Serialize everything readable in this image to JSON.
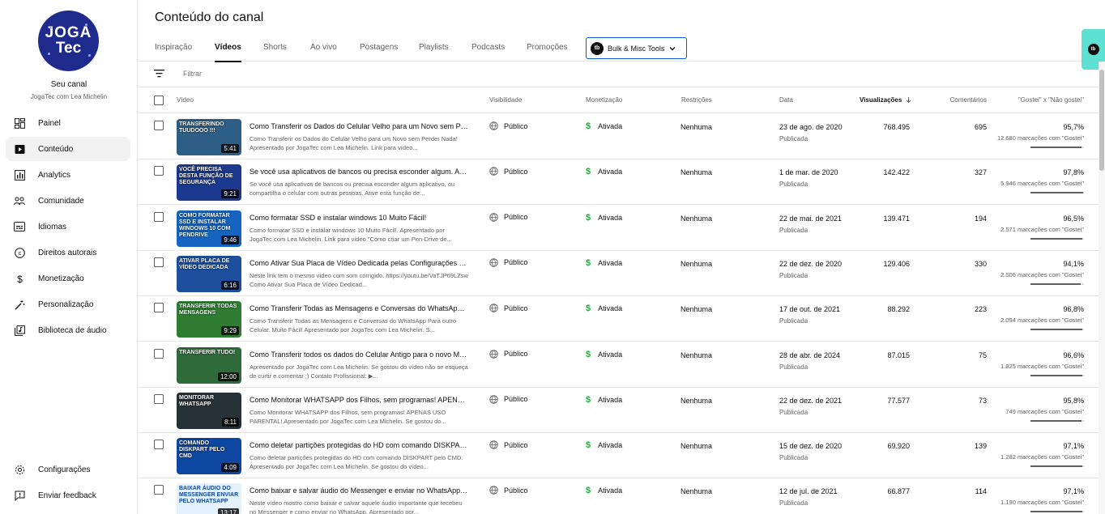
{
  "channel": {
    "avatar_line1": "JOGA",
    "avatar_line2": "Tec",
    "title": "Seu canal",
    "name": "JogaTec com Lea Michelin"
  },
  "nav": [
    {
      "label": "Painel",
      "icon": "dashboard-icon"
    },
    {
      "label": "Conteúdo",
      "icon": "content-icon",
      "active": true
    },
    {
      "label": "Analytics",
      "icon": "analytics-icon"
    },
    {
      "label": "Comunidade",
      "icon": "community-icon"
    },
    {
      "label": "Idiomas",
      "icon": "subtitles-icon"
    },
    {
      "label": "Direitos autorais",
      "icon": "copyright-icon"
    },
    {
      "label": "Monetização",
      "icon": "dollar-icon"
    },
    {
      "label": "Personalização",
      "icon": "magic-wand-icon"
    },
    {
      "label": "Biblioteca de áudio",
      "icon": "audio-library-icon"
    }
  ],
  "footer_nav": [
    {
      "label": "Configurações",
      "icon": "gear-icon"
    },
    {
      "label": "Enviar feedback",
      "icon": "feedback-icon"
    }
  ],
  "page_title": "Conteúdo do canal",
  "tabs": [
    "Inspiração",
    "Vídeos",
    "Shorts",
    "Ao vivo",
    "Postagens",
    "Playlists",
    "Podcasts",
    "Promoções"
  ],
  "active_tab": "Vídeos",
  "bulk_tools": {
    "label": "Bulk & Misc Tools",
    "logo": "tb"
  },
  "filter": {
    "placeholder": "Filtrar"
  },
  "columns": {
    "video": "Vídeo",
    "visibility": "Visibilidade",
    "monetization": "Monetização",
    "restrictions": "Restrições",
    "date": "Data",
    "views": "Visualizações",
    "comments": "Comentários",
    "likes": "\"Gostei\" x \"Não gostei\""
  },
  "colors": {
    "accent": "#0b57d0",
    "monetized": "#2ba640",
    "teal_tool": "#5ee0d3"
  },
  "videos": [
    {
      "thumb_text": "Transferindo TUUDOOO !!!",
      "thumb_color": "#2d5e86",
      "duration": "5:41",
      "title": "Como Transferir os Dados do Celular Velho para um Novo sem Perder Nada!",
      "desc": "Como Transferir os Dados do Celular Velho para um Novo sem Perder Nada! Apresentado por JogaTec com Lea Michelin. Link para vídeo...",
      "visibility": "Público",
      "monetization": "Ativada",
      "restrictions": "Nenhuma",
      "date": "23 de ago. de 2020",
      "status": "Publicada",
      "views": "768.495",
      "comments": "695",
      "like_pct": "95,7%",
      "like_ratio": 0.957,
      "like_count": "12.680 marcações com \"Gostei\""
    },
    {
      "thumb_text": "Você precisa desta função de segurança",
      "thumb_color": "#1b3a8f",
      "duration": "9:21",
      "title": "Se você usa aplicativos de bancos ou precisa esconder algum. Ativa esta função",
      "desc": "Se você usa aplicativos de bancos ou precisa esconder algum aplicativo, ou compartilha o celular com outras pessoas. Ative esta função de...",
      "visibility": "Público",
      "monetization": "Ativada",
      "restrictions": "Nenhuma",
      "date": "1 de mar. de 2020",
      "status": "Publicada",
      "views": "142.422",
      "comments": "327",
      "like_pct": "97,8%",
      "like_ratio": 0.978,
      "like_count": "5.946 marcações com \"Gostei\""
    },
    {
      "thumb_text": "Como formatar SSD e instalar Windows 10 com pendrive",
      "thumb_color": "#1565c0",
      "duration": "9:46",
      "title": "Como formatar SSD e instalar windows 10 Muito Fácil!",
      "desc": "Como formatar SSD e instalar windows 10 Muito Fácil!. Apresentado por JogaTec com Lea Michelin. Link para vídeo \"Como criar um Pen-Drive de...",
      "visibility": "Público",
      "monetization": "Ativada",
      "restrictions": "Nenhuma",
      "date": "22 de mai. de 2021",
      "status": "Publicada",
      "views": "139.471",
      "comments": "194",
      "like_pct": "96,5%",
      "like_ratio": 0.965,
      "like_count": "2.571 marcações com \"Gostei\""
    },
    {
      "thumb_text": "Ativar placa de vídeo dedicada",
      "thumb_color": "#1d4f9e",
      "duration": "6:16",
      "title": "Como Ativar Sua Placa de Vídeo Dedicada pelas Configurações do Windows",
      "desc": "Neste link tem o mesmo vídeo com som corrigido. https://youtu.be/VaTJP69LZsw Como Ativar Sua Placa de Vídeo Dedicad...",
      "visibility": "Público",
      "monetization": "Ativada",
      "restrictions": "Nenhuma",
      "date": "22 de dez. de 2020",
      "status": "Publicada",
      "views": "129.406",
      "comments": "330",
      "like_pct": "94,1%",
      "like_ratio": 0.941,
      "like_count": "2.506 marcações com \"Gostei\""
    },
    {
      "thumb_text": "Transferir todas mensagens",
      "thumb_color": "#2e7d32",
      "duration": "9:29",
      "title": "Como Transferir Todas as Mensagens e Conversas do WhatsApp Para outro Celular",
      "desc": "Como Transferir Todas as Mensagens e Conversas do WhatsApp Para outro Celular. Muito Fácil! Apresentado por JogaTec com Lea Michelin. S...",
      "visibility": "Público",
      "monetization": "Ativada",
      "restrictions": "Nenhuma",
      "date": "17 de out. de 2021",
      "status": "Publicada",
      "views": "88.292",
      "comments": "223",
      "like_pct": "96,8%",
      "like_ratio": 0.968,
      "like_count": "2.094 marcações com \"Gostei\""
    },
    {
      "thumb_text": "Transferir tudo!",
      "thumb_color": "#2f6b3a",
      "duration": "12:00",
      "title": "Como Transferir todos os dados do Celular Antigo para o novo Muito Fácil",
      "desc": "Apresentado por JogaTec com Lea Michelin. Se gostou do vídeo não se esqueça de curtir e comentar ;) Contato Profissional: ▶...",
      "visibility": "Público",
      "monetization": "Ativada",
      "restrictions": "Nenhuma",
      "date": "28 de abr. de 2024",
      "status": "Publicada",
      "views": "87.015",
      "comments": "75",
      "like_pct": "96,6%",
      "like_ratio": 0.966,
      "like_count": "1.825 marcações com \"Gostei\""
    },
    {
      "thumb_text": "Monitorar WhatsApp",
      "thumb_color": "#263238",
      "duration": "8:11",
      "title": "Como Monitorar WHATSAPP dos Filhos, sem programas! APENAS USO PARENTAL",
      "desc": "Como Monitorar WHATSAPP dos Filhos, sem programas! APENAS USO PARENTAL! Apresentado por JogaTec com Lea Michelin. Se gostou do...",
      "visibility": "Público",
      "monetization": "Ativada",
      "restrictions": "Nenhuma",
      "date": "22 de dez. de 2021",
      "status": "Publicada",
      "views": "77.577",
      "comments": "73",
      "like_pct": "95,8%",
      "like_ratio": 0.958,
      "like_count": "749 marcações com \"Gostei\""
    },
    {
      "thumb_text": "Comando DISKPART pelo CMD",
      "thumb_color": "#0d47a1",
      "duration": "4:09",
      "title": "Como deletar partições protegidas do HD com comando DISKPART pelo CMD",
      "desc": "Como deletar partições protegidas do HD com comando DISKPART pelo CMD. Apresentado por JogaTec com Lea Michelin. Se gostou do vídeo...",
      "visibility": "Público",
      "monetization": "Ativada",
      "restrictions": "Nenhuma",
      "date": "15 de dez. de 2020",
      "status": "Publicada",
      "views": "69.920",
      "comments": "139",
      "like_pct": "97,1%",
      "like_ratio": 0.971,
      "like_count": "1.282 marcações com \"Gostei\""
    },
    {
      "thumb_text": "Baixar áudio do Messenger enviar pelo WhatsApp",
      "thumb_color": "#e3f2fd",
      "duration": "13:17",
      "title": "Como baixar e salvar áudio do Messenger e enviar no WhatsApp (Atualizado)",
      "desc": "Neste vídeo mostro como baixar e salvar aquele áudio importante que recebeu no Messenger e como enviar no WhatsApp. Apresentado por...",
      "visibility": "Público",
      "monetization": "Ativada",
      "restrictions": "Nenhuma",
      "date": "12 de jul. de 2021",
      "status": "Publicada",
      "views": "66.877",
      "comments": "114",
      "like_pct": "97,1%",
      "like_ratio": 0.971,
      "like_count": "1.190 marcações com \"Gostei\""
    }
  ]
}
